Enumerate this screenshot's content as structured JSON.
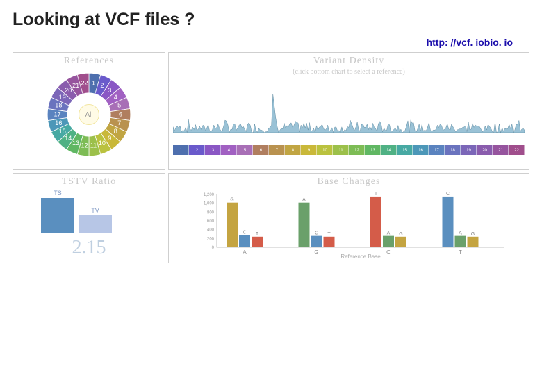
{
  "title": "Looking at VCF files ?",
  "link_text": "http: //vcf. iobio. io",
  "panels": {
    "references": {
      "title": "References",
      "center": "All",
      "segments": [
        "1",
        "2",
        "3",
        "4",
        "5",
        "6",
        "7",
        "8",
        "9",
        "10",
        "11",
        "12",
        "13",
        "14",
        "15",
        "16",
        "17",
        "18",
        "19",
        "20",
        "21",
        "22"
      ]
    },
    "density": {
      "title": "Variant Density",
      "subtitle": "(click bottom chart to select a reference)",
      "bottom_labels": [
        "1",
        "2",
        "3",
        "4",
        "5",
        "6",
        "7",
        "8",
        "9",
        "10",
        "11",
        "12",
        "13",
        "14",
        "15",
        "16",
        "17",
        "18",
        "19",
        "20",
        "21",
        "22"
      ]
    },
    "tstv": {
      "title": "TSTV Ratio",
      "bars": [
        {
          "label": "TS",
          "h": 1.0
        },
        {
          "label": "TV",
          "h": 0.5
        }
      ],
      "value": "2.15",
      "colors": [
        "#5a8fbf",
        "#b7c6e6"
      ]
    },
    "basechanges": {
      "title": "Base Changes",
      "yticks": [
        "1,200",
        "1,000",
        "800",
        "600",
        "400",
        "200",
        "0"
      ],
      "xlabel": "Reference Base",
      "groups": [
        {
          "ref": "A",
          "bars": [
            {
              "lab": "G",
              "v": 1100,
              "c": "#c4a441"
            },
            {
              "lab": "C",
              "v": 300,
              "c": "#5a8fbf"
            },
            {
              "lab": "T",
              "v": 260,
              "c": "#d45c49"
            }
          ]
        },
        {
          "ref": "G",
          "bars": [
            {
              "lab": "A",
              "v": 1100,
              "c": "#6aa06a"
            },
            {
              "lab": "C",
              "v": 280,
              "c": "#5a8fbf"
            },
            {
              "lab": "T",
              "v": 260,
              "c": "#d45c49"
            }
          ]
        },
        {
          "ref": "C",
          "bars": [
            {
              "lab": "T",
              "v": 1250,
              "c": "#d45c49"
            },
            {
              "lab": "A",
              "v": 280,
              "c": "#6aa06a"
            },
            {
              "lab": "G",
              "v": 260,
              "c": "#c4a441"
            }
          ]
        },
        {
          "ref": "T",
          "bars": [
            {
              "lab": "C",
              "v": 1250,
              "c": "#5a8fbf"
            },
            {
              "lab": "A",
              "v": 280,
              "c": "#6aa06a"
            },
            {
              "lab": "G",
              "v": 260,
              "c": "#c4a441"
            }
          ]
        }
      ],
      "ymax": 1300
    }
  },
  "chart_data": [
    {
      "type": "pie",
      "title": "References",
      "categories": [
        "1",
        "2",
        "3",
        "4",
        "5",
        "6",
        "7",
        "8",
        "9",
        "10",
        "11",
        "12",
        "13",
        "14",
        "15",
        "16",
        "17",
        "18",
        "19",
        "20",
        "21",
        "22"
      ],
      "values": [
        1,
        1,
        1,
        1,
        1,
        1,
        1,
        1,
        1,
        1,
        1,
        1,
        1,
        1,
        1,
        1,
        1,
        1,
        1,
        1,
        1,
        1
      ],
      "center_label": "All"
    },
    {
      "type": "line",
      "title": "Variant Density",
      "subtitle": "(click bottom chart to select a reference)",
      "x": [
        "1",
        "2",
        "3",
        "4",
        "5",
        "6",
        "7",
        "8",
        "9",
        "10",
        "11",
        "12",
        "13",
        "14",
        "15",
        "16",
        "17",
        "18",
        "19",
        "20",
        "21",
        "22"
      ],
      "values": null,
      "note": "dense noisy trace per chromosome with one tall spike near chr 6–7 region"
    },
    {
      "type": "bar",
      "title": "TSTV Ratio",
      "categories": [
        "TS",
        "TV"
      ],
      "values": [
        2.15,
        1.0
      ],
      "annotation": "2.15"
    },
    {
      "type": "bar",
      "title": "Base Changes",
      "xlabel": "Reference Base",
      "ylim": [
        0,
        1300
      ],
      "categories": [
        "A",
        "G",
        "C",
        "T"
      ],
      "series": [
        {
          "name": "→G",
          "values": [
            1100,
            null,
            260,
            260
          ]
        },
        {
          "name": "→C",
          "values": [
            300,
            280,
            null,
            1250
          ]
        },
        {
          "name": "→T",
          "values": [
            260,
            260,
            1250,
            null
          ]
        },
        {
          "name": "→A",
          "values": [
            null,
            1100,
            280,
            280
          ]
        }
      ]
    }
  ]
}
